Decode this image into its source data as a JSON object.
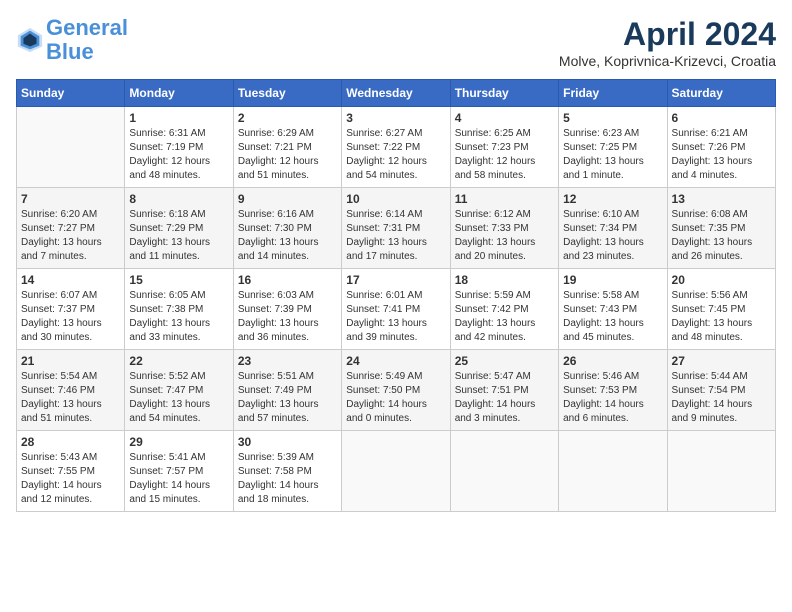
{
  "header": {
    "logo_line1": "General",
    "logo_line2": "Blue",
    "month_title": "April 2024",
    "location": "Molve, Koprivnica-Krizevci, Croatia"
  },
  "days_of_week": [
    "Sunday",
    "Monday",
    "Tuesday",
    "Wednesday",
    "Thursday",
    "Friday",
    "Saturday"
  ],
  "weeks": [
    [
      {
        "day": "",
        "info": ""
      },
      {
        "day": "1",
        "info": "Sunrise: 6:31 AM\nSunset: 7:19 PM\nDaylight: 12 hours\nand 48 minutes."
      },
      {
        "day": "2",
        "info": "Sunrise: 6:29 AM\nSunset: 7:21 PM\nDaylight: 12 hours\nand 51 minutes."
      },
      {
        "day": "3",
        "info": "Sunrise: 6:27 AM\nSunset: 7:22 PM\nDaylight: 12 hours\nand 54 minutes."
      },
      {
        "day": "4",
        "info": "Sunrise: 6:25 AM\nSunset: 7:23 PM\nDaylight: 12 hours\nand 58 minutes."
      },
      {
        "day": "5",
        "info": "Sunrise: 6:23 AM\nSunset: 7:25 PM\nDaylight: 13 hours\nand 1 minute."
      },
      {
        "day": "6",
        "info": "Sunrise: 6:21 AM\nSunset: 7:26 PM\nDaylight: 13 hours\nand 4 minutes."
      }
    ],
    [
      {
        "day": "7",
        "info": "Sunrise: 6:20 AM\nSunset: 7:27 PM\nDaylight: 13 hours\nand 7 minutes."
      },
      {
        "day": "8",
        "info": "Sunrise: 6:18 AM\nSunset: 7:29 PM\nDaylight: 13 hours\nand 11 minutes."
      },
      {
        "day": "9",
        "info": "Sunrise: 6:16 AM\nSunset: 7:30 PM\nDaylight: 13 hours\nand 14 minutes."
      },
      {
        "day": "10",
        "info": "Sunrise: 6:14 AM\nSunset: 7:31 PM\nDaylight: 13 hours\nand 17 minutes."
      },
      {
        "day": "11",
        "info": "Sunrise: 6:12 AM\nSunset: 7:33 PM\nDaylight: 13 hours\nand 20 minutes."
      },
      {
        "day": "12",
        "info": "Sunrise: 6:10 AM\nSunset: 7:34 PM\nDaylight: 13 hours\nand 23 minutes."
      },
      {
        "day": "13",
        "info": "Sunrise: 6:08 AM\nSunset: 7:35 PM\nDaylight: 13 hours\nand 26 minutes."
      }
    ],
    [
      {
        "day": "14",
        "info": "Sunrise: 6:07 AM\nSunset: 7:37 PM\nDaylight: 13 hours\nand 30 minutes."
      },
      {
        "day": "15",
        "info": "Sunrise: 6:05 AM\nSunset: 7:38 PM\nDaylight: 13 hours\nand 33 minutes."
      },
      {
        "day": "16",
        "info": "Sunrise: 6:03 AM\nSunset: 7:39 PM\nDaylight: 13 hours\nand 36 minutes."
      },
      {
        "day": "17",
        "info": "Sunrise: 6:01 AM\nSunset: 7:41 PM\nDaylight: 13 hours\nand 39 minutes."
      },
      {
        "day": "18",
        "info": "Sunrise: 5:59 AM\nSunset: 7:42 PM\nDaylight: 13 hours\nand 42 minutes."
      },
      {
        "day": "19",
        "info": "Sunrise: 5:58 AM\nSunset: 7:43 PM\nDaylight: 13 hours\nand 45 minutes."
      },
      {
        "day": "20",
        "info": "Sunrise: 5:56 AM\nSunset: 7:45 PM\nDaylight: 13 hours\nand 48 minutes."
      }
    ],
    [
      {
        "day": "21",
        "info": "Sunrise: 5:54 AM\nSunset: 7:46 PM\nDaylight: 13 hours\nand 51 minutes."
      },
      {
        "day": "22",
        "info": "Sunrise: 5:52 AM\nSunset: 7:47 PM\nDaylight: 13 hours\nand 54 minutes."
      },
      {
        "day": "23",
        "info": "Sunrise: 5:51 AM\nSunset: 7:49 PM\nDaylight: 13 hours\nand 57 minutes."
      },
      {
        "day": "24",
        "info": "Sunrise: 5:49 AM\nSunset: 7:50 PM\nDaylight: 14 hours\nand 0 minutes."
      },
      {
        "day": "25",
        "info": "Sunrise: 5:47 AM\nSunset: 7:51 PM\nDaylight: 14 hours\nand 3 minutes."
      },
      {
        "day": "26",
        "info": "Sunrise: 5:46 AM\nSunset: 7:53 PM\nDaylight: 14 hours\nand 6 minutes."
      },
      {
        "day": "27",
        "info": "Sunrise: 5:44 AM\nSunset: 7:54 PM\nDaylight: 14 hours\nand 9 minutes."
      }
    ],
    [
      {
        "day": "28",
        "info": "Sunrise: 5:43 AM\nSunset: 7:55 PM\nDaylight: 14 hours\nand 12 minutes."
      },
      {
        "day": "29",
        "info": "Sunrise: 5:41 AM\nSunset: 7:57 PM\nDaylight: 14 hours\nand 15 minutes."
      },
      {
        "day": "30",
        "info": "Sunrise: 5:39 AM\nSunset: 7:58 PM\nDaylight: 14 hours\nand 18 minutes."
      },
      {
        "day": "",
        "info": ""
      },
      {
        "day": "",
        "info": ""
      },
      {
        "day": "",
        "info": ""
      },
      {
        "day": "",
        "info": ""
      }
    ]
  ]
}
